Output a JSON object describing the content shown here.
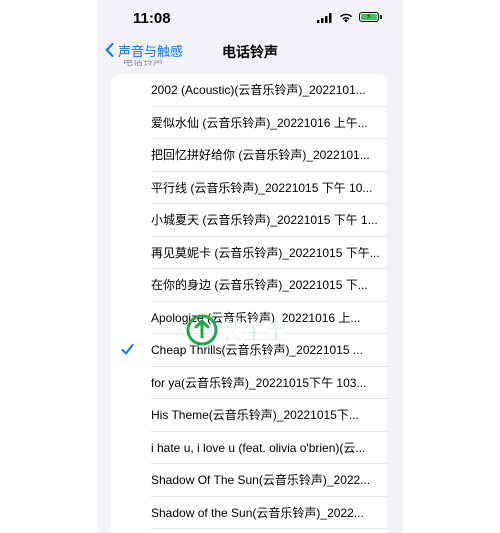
{
  "status_bar": {
    "time": "11:08",
    "icons": [
      "signal-icon",
      "wifi-icon",
      "battery-icon"
    ],
    "battery_color": "#34c759"
  },
  "nav": {
    "back_label": "声音与触感",
    "title": "电话铃声"
  },
  "section": {
    "header": "电话铃声"
  },
  "accent_color": "#007aff",
  "ringtones": [
    {
      "label": "2002 (Acoustic)(云音乐铃声)_2022101...",
      "selected": false
    },
    {
      "label": "爱似水仙 (云音乐铃声)_20221016 上午...",
      "selected": false
    },
    {
      "label": "把回忆拼好给你 (云音乐铃声)_2022101...",
      "selected": false
    },
    {
      "label": "平行线 (云音乐铃声)_20221015 下午 10...",
      "selected": false
    },
    {
      "label": "小城夏天 (云音乐铃声)_20221015 下午 1...",
      "selected": false
    },
    {
      "label": "再见莫妮卡 (云音乐铃声)_20221015 下午...",
      "selected": false
    },
    {
      "label": "在你的身边 (云音乐铃声)_20221015 下...",
      "selected": false
    },
    {
      "label": "Apologize (云音乐铃声)_20221016 上...",
      "selected": false
    },
    {
      "label": "Cheap Thrills(云音乐铃声)_20221015 ...",
      "selected": true
    },
    {
      "label": "for ya(云音乐铃声)_20221015下午 103...",
      "selected": false
    },
    {
      "label": "His Theme(云音乐铃声)_20221015下...",
      "selected": false
    },
    {
      "label": "i hate u, i love u (feat. olivia o'brien)(云...",
      "selected": false
    },
    {
      "label": "Shadow Of The Sun(云音乐铃声)_2022...",
      "selected": false
    },
    {
      "label": "Shadow of the Sun(云音乐铃声)_2022...",
      "selected": false
    }
  ],
  "watermark": {
    "text": "装主圭"
  }
}
